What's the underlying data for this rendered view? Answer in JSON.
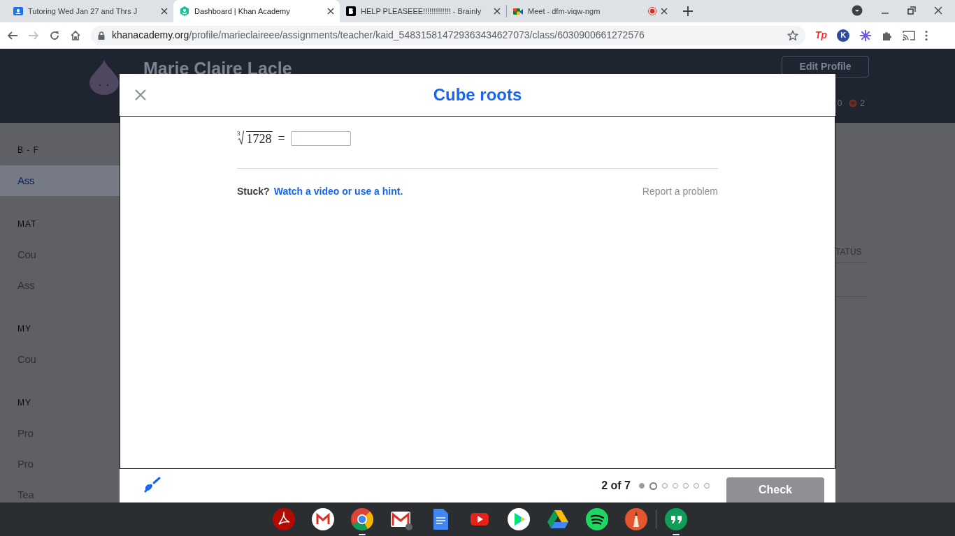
{
  "browser": {
    "tabs": [
      {
        "title": "Tutoring Wed Jan 27 and Thrs J",
        "selected": false,
        "recording": false
      },
      {
        "title": "Dashboard | Khan Academy",
        "selected": true,
        "recording": false
      },
      {
        "title": "HELP PLEASEEE!!!!!!!!!!!!! - Brainly",
        "selected": false,
        "recording": false
      },
      {
        "title": "Meet - dfm-viqw-ngm",
        "selected": false,
        "recording": true
      }
    ],
    "url_host": "khanacademy.org",
    "url_path": "/profile/marieclaireee/assignments/teacher/kaid_548315814729363434627073/class/6030900661272576",
    "extension_tp": "Tp",
    "extension_k": "K"
  },
  "profile": {
    "name": "Marie Claire Lacle",
    "edit_button": "Edit Profile",
    "count_a": "0",
    "count_b": "2"
  },
  "sidebar": [
    {
      "kind": "heading",
      "text": "B - F"
    },
    {
      "kind": "link",
      "text": "Ass",
      "selected": true
    },
    {
      "kind": "heading",
      "text": "MAT"
    },
    {
      "kind": "link",
      "text": "Cou",
      "selected": false
    },
    {
      "kind": "link",
      "text": "Ass",
      "selected": false
    },
    {
      "kind": "heading",
      "text": "MY"
    },
    {
      "kind": "link",
      "text": "Cou",
      "selected": false
    },
    {
      "kind": "heading",
      "text": "MY"
    },
    {
      "kind": "link",
      "text": "Pro",
      "selected": false
    },
    {
      "kind": "link",
      "text": "Pro",
      "selected": false
    },
    {
      "kind": "link",
      "text": "Tea",
      "selected": false
    }
  ],
  "table_header_fragment": "TATUS",
  "exercise": {
    "title": "Cube roots",
    "root_index": "3",
    "radicand": "1728",
    "equals": "=",
    "stuck_label": "Stuck?",
    "hint_link": "Watch a video or use a hint.",
    "report_link": "Report a problem"
  },
  "footer": {
    "progress": "2 of 7",
    "dots": [
      {
        "completed": true,
        "selected": false
      },
      {
        "completed": false,
        "selected": true
      },
      {
        "completed": false,
        "selected": false
      },
      {
        "completed": false,
        "selected": false
      },
      {
        "completed": false,
        "selected": false
      },
      {
        "completed": false,
        "selected": false
      },
      {
        "completed": false,
        "selected": false
      }
    ],
    "check_button": {
      "label": "Check",
      "disabled": true
    }
  },
  "shelf": [
    {
      "kind": "acrobat",
      "open": false
    },
    {
      "kind": "gmail",
      "open": false
    },
    {
      "kind": "chrome",
      "open": true
    },
    {
      "kind": "gmail-offline",
      "open": false
    },
    {
      "kind": "docs",
      "open": false
    },
    {
      "kind": "youtube",
      "open": false
    },
    {
      "kind": "play",
      "open": false
    },
    {
      "kind": "drive",
      "open": false
    },
    {
      "kind": "spotify",
      "open": false
    },
    {
      "kind": "sketch",
      "open": false
    },
    {
      "kind": "hangouts",
      "open": true
    }
  ]
}
